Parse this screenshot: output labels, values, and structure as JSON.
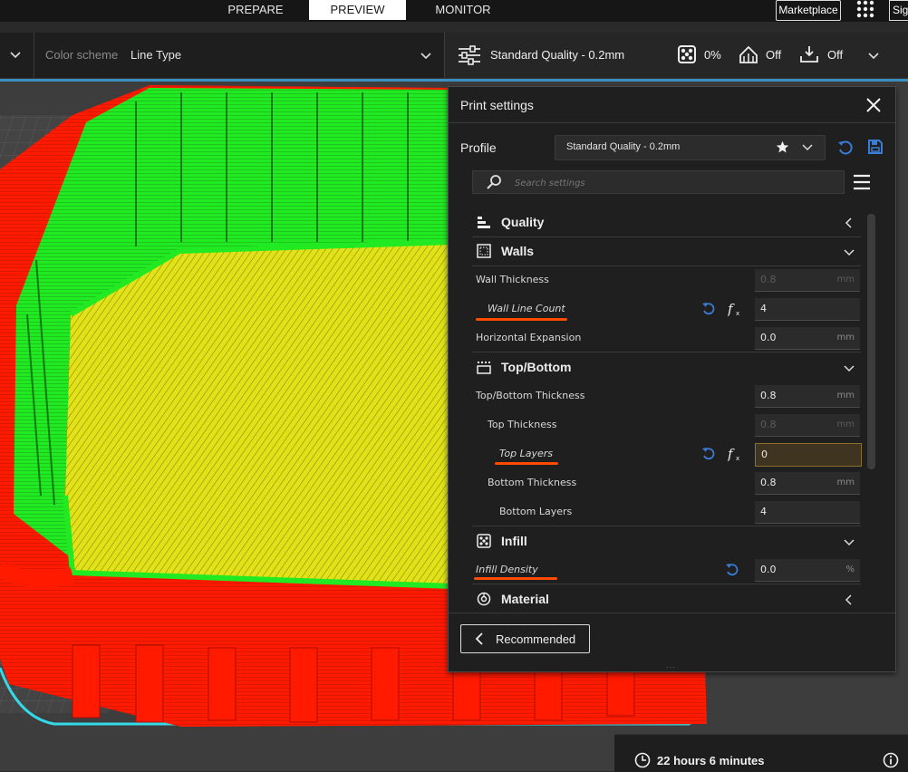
{
  "nav": {
    "tabs": [
      {
        "label": "PREPARE",
        "active": false
      },
      {
        "label": "PREVIEW",
        "active": true
      },
      {
        "label": "MONITOR",
        "active": false
      }
    ],
    "marketplace_label": "Marketplace",
    "sign_in_label": "Sig"
  },
  "toolbar": {
    "color_scheme_label": "Color scheme",
    "color_scheme_value": "Line Type",
    "quality_summary": "Standard Quality - 0.2mm",
    "infill_value": "0%",
    "support_value": "Off",
    "adhesion_value": "Off"
  },
  "print_settings": {
    "title": "Print settings",
    "profile_label": "Profile",
    "profile_value": "Standard Quality - 0.2mm",
    "search_placeholder": "Search settings",
    "categories": {
      "quality": "Quality",
      "walls": "Walls",
      "top_bottom": "Top/Bottom",
      "infill": "Infill",
      "material": "Material"
    },
    "settings": {
      "wall_thickness": {
        "label": "Wall Thickness",
        "value": "0.8",
        "unit": "mm"
      },
      "wall_line_count": {
        "label": "Wall Line Count",
        "value": "4"
      },
      "horizontal_expansion": {
        "label": "Horizontal Expansion",
        "value": "0.0",
        "unit": "mm"
      },
      "top_bottom_thickness": {
        "label": "Top/Bottom Thickness",
        "value": "0.8",
        "unit": "mm"
      },
      "top_thickness": {
        "label": "Top Thickness",
        "value": "0.8",
        "unit": "mm"
      },
      "top_layers": {
        "label": "Top Layers",
        "value": "0"
      },
      "bottom_thickness": {
        "label": "Bottom Thickness",
        "value": "0.8",
        "unit": "mm"
      },
      "bottom_layers": {
        "label": "Bottom Layers",
        "value": "4"
      },
      "infill_density": {
        "label": "Infill Density",
        "value": "0.0",
        "unit": "%"
      }
    },
    "recommended_label": "Recommended"
  },
  "print_time": "22 hours 6 minutes",
  "colors": {
    "wall_outer": "#ff1a00",
    "wall_inner": "#1fe61f",
    "top_bottom_skin": "#e6e61a",
    "travel": "#33d9e6",
    "accent_blue": "#3a7bd5",
    "annotation_underline": "#ff4a00"
  }
}
